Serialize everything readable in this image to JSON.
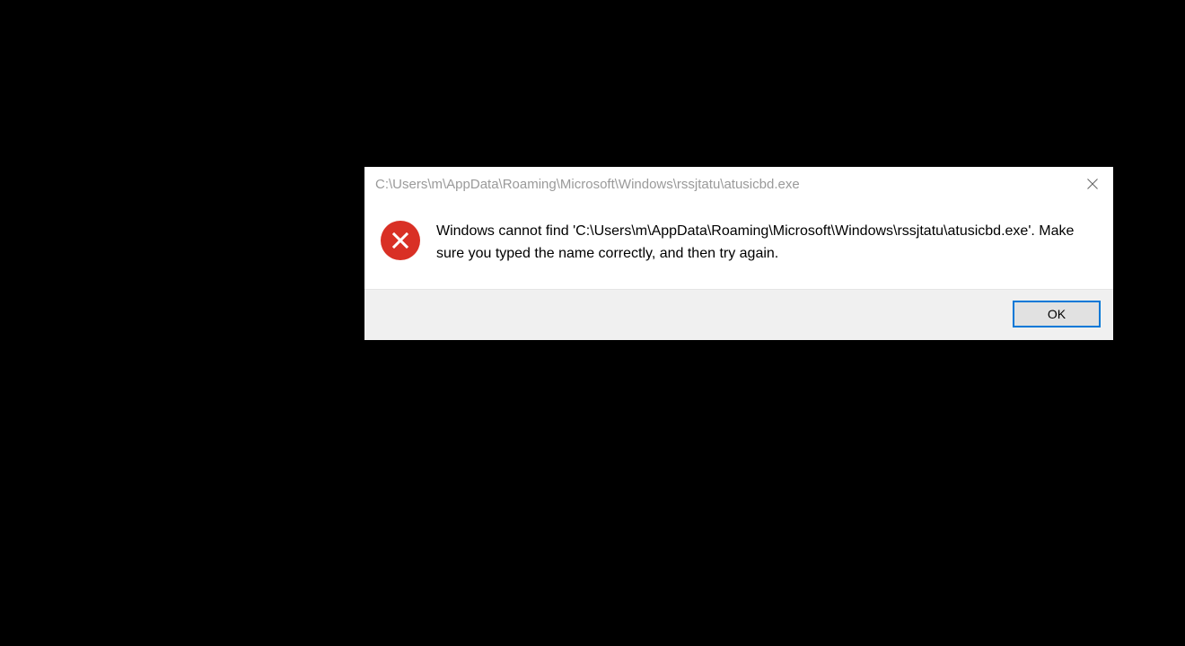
{
  "dialog": {
    "title": "C:\\Users\\m\\AppData\\Roaming\\Microsoft\\Windows\\rssjtatu\\atusicbd.exe",
    "message": "Windows cannot find 'C:\\Users\\m\\AppData\\Roaming\\Microsoft\\Windows\\rssjtatu\\atusicbd.exe'. Make sure you typed the name correctly, and then try again.",
    "ok_label": "OK",
    "icon": "error-x-icon",
    "close_icon": "close-icon"
  }
}
